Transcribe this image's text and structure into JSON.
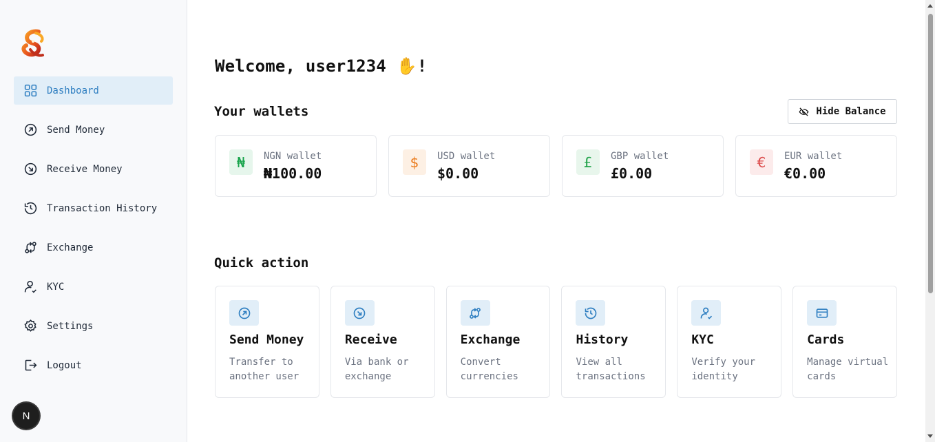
{
  "sidebar": {
    "logo_icon": "brand-logo-icon",
    "items": [
      {
        "label": "Dashboard",
        "icon": "grid-icon",
        "active": true
      },
      {
        "label": "Send Money",
        "icon": "arrow-up-right-circle-icon"
      },
      {
        "label": "Receive Money",
        "icon": "arrow-down-right-circle-icon"
      },
      {
        "label": "Transaction History",
        "icon": "history-icon"
      },
      {
        "label": "Exchange",
        "icon": "exchange-icon"
      },
      {
        "label": "KYC",
        "icon": "user-check-icon"
      },
      {
        "label": "Settings",
        "icon": "gear-icon"
      },
      {
        "label": "Logout",
        "icon": "logout-icon"
      }
    ],
    "avatar_letter": "N"
  },
  "main": {
    "welcome": "Welcome, user1234 ✋!",
    "wallets_title": "Your wallets",
    "hide_balance_label": "Hide Balance",
    "wallets": [
      {
        "symbol": "₦",
        "label": "NGN wallet",
        "amount": "₦100.00",
        "color": "#16a34a",
        "bg": "#e6f6ec"
      },
      {
        "symbol": "$",
        "label": "USD wallet",
        "amount": "$0.00",
        "color": "#ea7a1b",
        "bg": "#fdf0e4"
      },
      {
        "symbol": "£",
        "label": "GBP wallet",
        "amount": "£0.00",
        "color": "#22a34a",
        "bg": "#e8f6ec"
      },
      {
        "symbol": "€",
        "label": "EUR wallet",
        "amount": "€0.00",
        "color": "#dc4a4a",
        "bg": "#fcebeb"
      }
    ],
    "quick_action_title": "Quick action",
    "actions": [
      {
        "title": "Send Money",
        "desc": "Transfer to another user",
        "icon": "arrow-up-right-circle-icon"
      },
      {
        "title": "Receive",
        "desc": "Via bank or exchange",
        "icon": "arrow-down-right-circle-icon"
      },
      {
        "title": "Exchange",
        "desc": "Convert currencies",
        "icon": "exchange-icon"
      },
      {
        "title": "History",
        "desc": "View all transactions",
        "icon": "history-icon"
      },
      {
        "title": "KYC",
        "desc": "Verify your identity",
        "icon": "user-check-icon"
      },
      {
        "title": "Cards",
        "desc": "Manage virtual cards",
        "icon": "credit-card-icon"
      }
    ]
  },
  "colors": {
    "accent": "#2f7fc1",
    "active_bg": "#e1eef8"
  }
}
